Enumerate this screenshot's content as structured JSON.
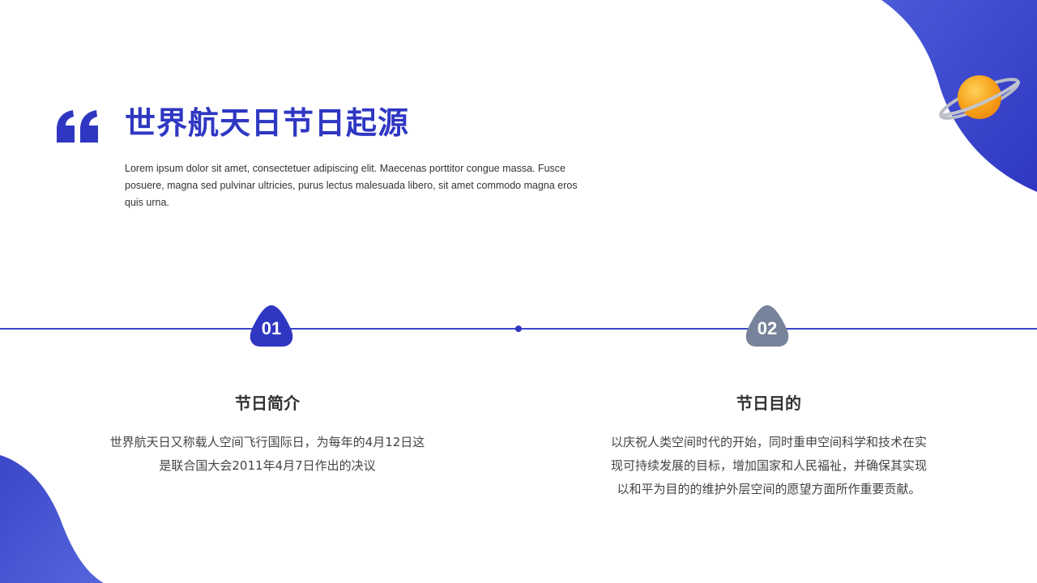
{
  "title": "世界航天日节日起源",
  "intro": "Lorem ipsum dolor sit amet, consectetuer adipiscing elit. Maecenas porttitor congue massa. Fusce posuere, magna sed pulvinar ultricies, purus lectus malesuada libero, sit amet commodo magna eros quis urna.",
  "icons": {
    "quote": "quote-mark-icon",
    "planet": "planet-icon"
  },
  "colors": {
    "primary": "#2f37c2",
    "accent_blue": "#3a47c9",
    "muted": "#76839a",
    "planet": "#f7a21b"
  },
  "sections": [
    {
      "number": "01",
      "title": "节日简介",
      "body_lines": [
        "世界航天日又称载人空间飞行国际日，为每年的4月12日这",
        "是联合国大会2011年4月7日作出的决议"
      ]
    },
    {
      "number": "02",
      "title": "节日目的",
      "body_lines": [
        "以庆祝人类空间时代的开始，同时重申空间科学和技术在实",
        "现可持续发展的目标，增加国家和人民福祉，并确保其实现",
        "以和平为目的的维护外层空间的愿望方面所作重要贡献。"
      ]
    }
  ]
}
